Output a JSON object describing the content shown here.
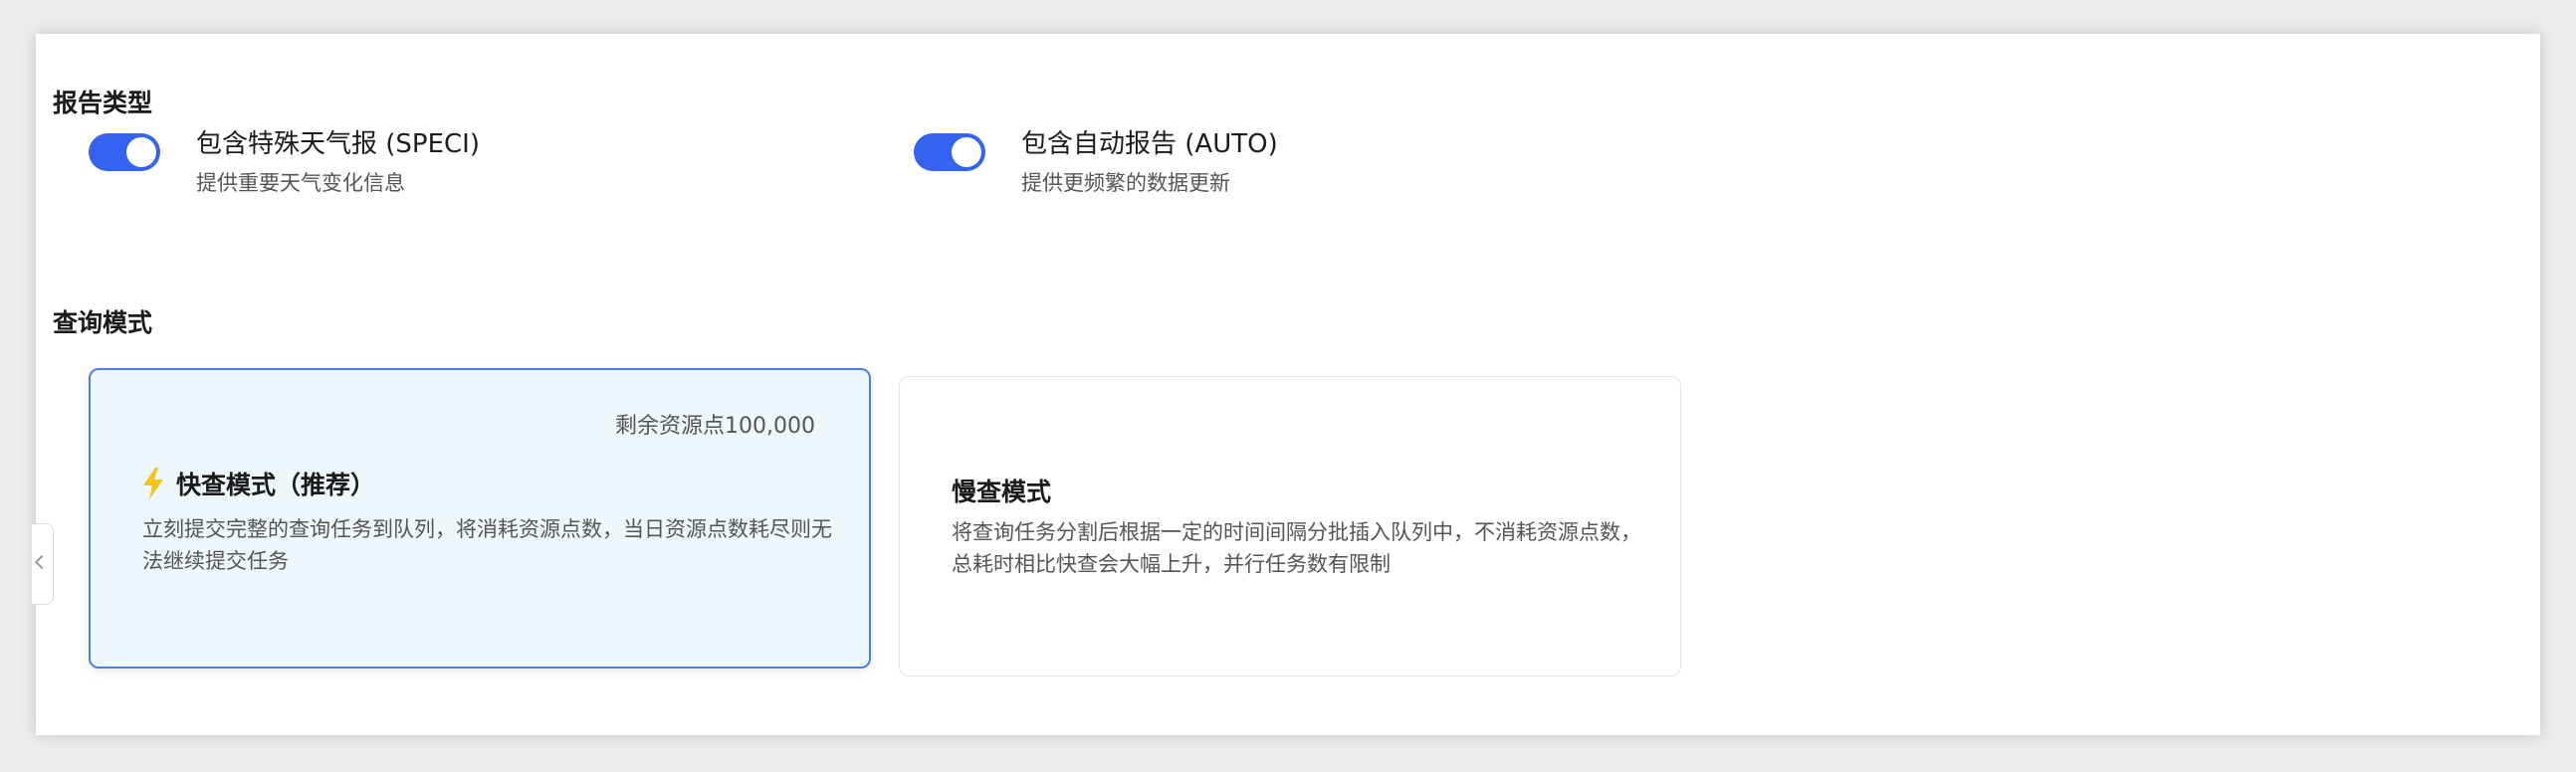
{
  "report_type": {
    "title": "报告类型",
    "options": [
      {
        "label": "包含特殊天气报 (SPECI)",
        "description": "提供重要天气变化信息",
        "enabled": true
      },
      {
        "label": "包含自动报告 (AUTO)",
        "description": "提供更频繁的数据更新",
        "enabled": true
      }
    ]
  },
  "query_mode": {
    "title": "查询模式",
    "cards": [
      {
        "badge": "剩余资源点100,000",
        "title": "快查模式（推荐）",
        "description": "立刻提交完整的查询任务到队列，将消耗资源点数，当日资源点数耗尽则无法继续提交任务",
        "icon": "lightning-bolt-icon",
        "selected": true
      },
      {
        "title": "慢查模式",
        "description": "将查询任务分割后根据一定的时间间隔分批插入队列中，不消耗资源点数，总耗时相比快查会大幅上升，并行任务数有限制",
        "selected": false
      }
    ]
  },
  "colors": {
    "accent": "#3363f0",
    "selected_card_bg": "#ecf8fb",
    "selected_card_border": "#4f7cf0",
    "bolt": "#f5c518"
  }
}
